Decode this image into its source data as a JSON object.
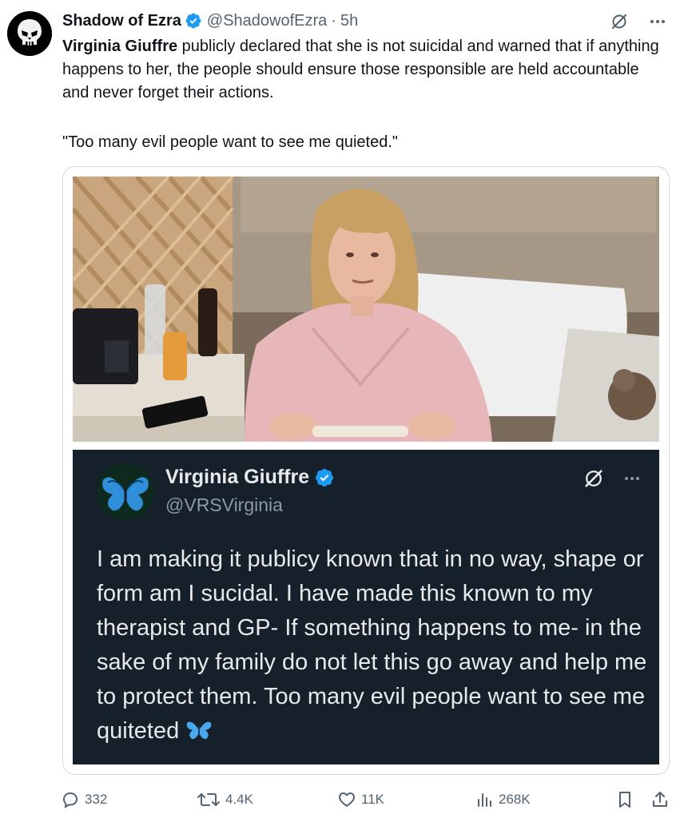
{
  "tweet": {
    "author_name": "Shadow of Ezra",
    "handle": "@ShadowofEzra",
    "separator": "·",
    "time": "5h",
    "text_bold": "Virginia Giuffre",
    "text_rest": " publicly declared that she is not suicidal and warned that if anything happens to her, the people should ensure those responsible are held accountable and never forget their actions.",
    "quote": "\"Too many evil people want to see me quieted.\""
  },
  "embedded_post": {
    "author_name": "Virginia Giuffre",
    "handle": "@VRSVirginia",
    "text": "I am making it publicy known that in no way, shape or form am I sucidal. I have made this known to my therapist and GP- If something happens to me- in the sake of my family do not let this go away and help me to protect them. Too many evil people want to see me quiteted"
  },
  "actions": {
    "replies": "332",
    "reposts": "4.4K",
    "likes": "11K",
    "views": "268K"
  },
  "icons": {
    "verified": "verified-badge-icon",
    "grok": "grok-icon",
    "more": "more-icon",
    "reply": "reply-icon",
    "repost": "repost-icon",
    "like": "heart-icon",
    "views": "analytics-icon",
    "bookmark": "bookmark-icon",
    "share": "share-icon",
    "butterfly": "butterfly-emoji-icon"
  },
  "colors": {
    "verified_blue": "#1d9bf0",
    "embed_background": "#15202b",
    "secondary_text": "#536471"
  }
}
